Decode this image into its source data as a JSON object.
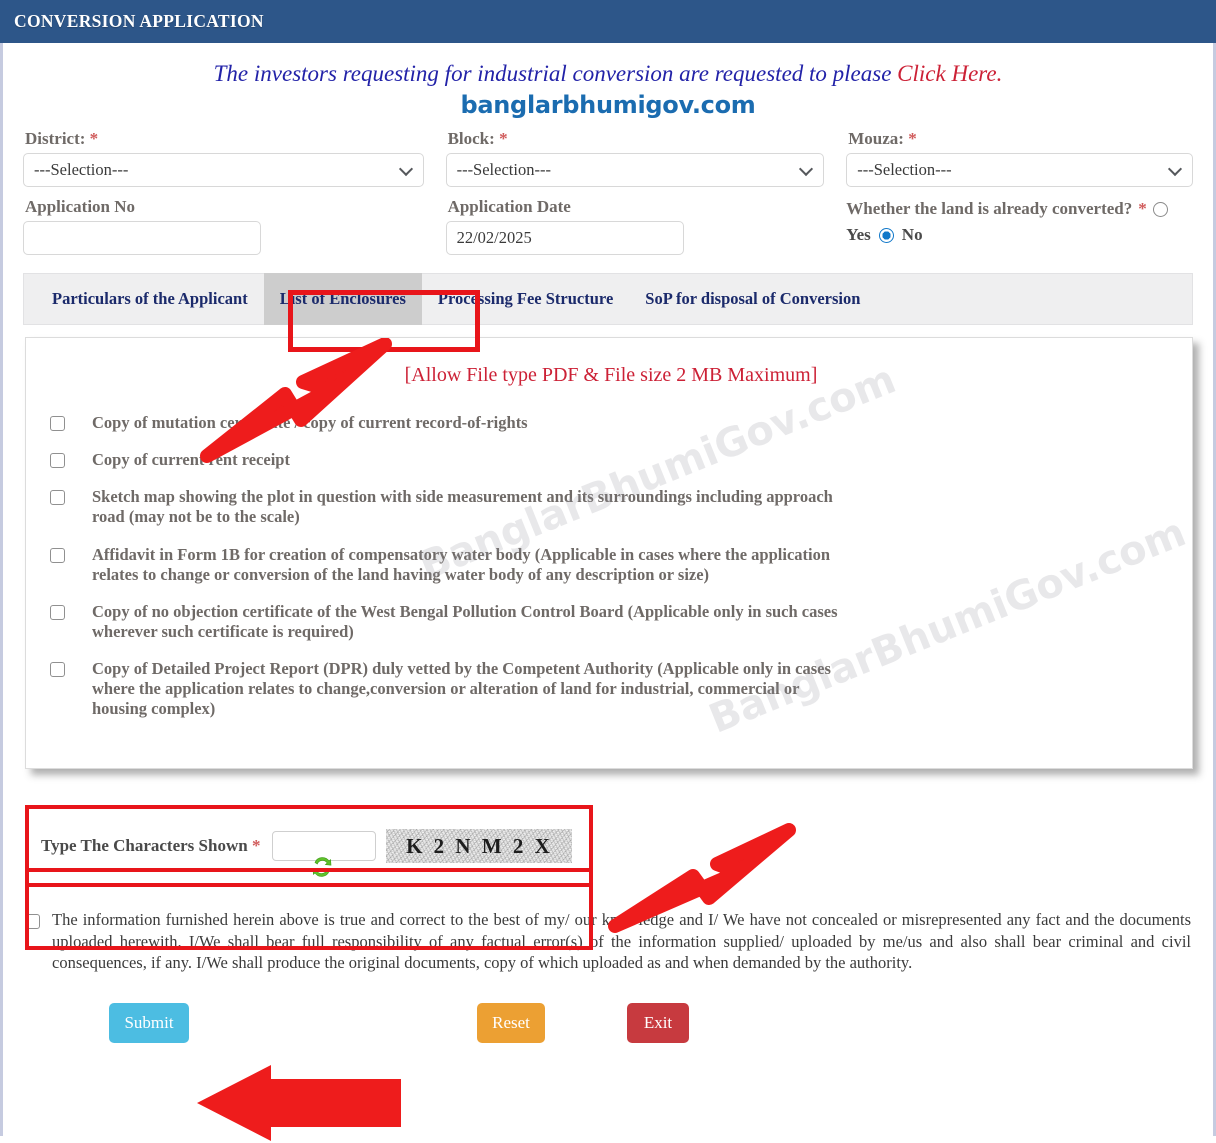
{
  "header": {
    "title": "CONVERSION APPLICATION"
  },
  "banner": {
    "text": "The investors requesting for industrial conversion are requested to please ",
    "link": "Click Here.",
    "site": "banglarbhumigov.com"
  },
  "watermark": {
    "text": "BanglarBhumiGov.com"
  },
  "form": {
    "district": {
      "label": "District:",
      "required": "*",
      "value": "---Selection---"
    },
    "block": {
      "label": "Block:",
      "required": "*",
      "value": "---Selection---"
    },
    "mouza": {
      "label": "Mouza:",
      "required": "*",
      "value": "---Selection---"
    },
    "application_no": {
      "label": "Application No",
      "value": ""
    },
    "application_date": {
      "label": "Application Date",
      "value": "22/02/2025"
    },
    "converted": {
      "question": "Whether the land is already converted?",
      "required": "*",
      "yes_label": "Yes",
      "no_label": "No",
      "selected": "No"
    }
  },
  "tabs": [
    {
      "label": "Particulars of the Applicant",
      "active": false
    },
    {
      "label": "List of Enclosures",
      "active": true
    },
    {
      "label": "Processing Fee Structure",
      "active": false
    },
    {
      "label": "SoP for disposal of Conversion",
      "active": false
    }
  ],
  "enclosures": {
    "note": "[Allow File type PDF & File size 2 MB Maximum]",
    "items": [
      {
        "label": "Copy of mutation certificate / copy of current record-of-rights",
        "checked": false
      },
      {
        "label": "Copy of current rent receipt",
        "checked": false
      },
      {
        "label": "Sketch map showing the plot in question with side measurement and its surroundings including approach road (may not be to the scale)",
        "checked": false
      },
      {
        "label": "Affidavit in Form 1B for creation of compensatory water body (Applicable in cases where the application relates to change or conversion of the land having water body of any description or size)",
        "checked": false
      },
      {
        "label": "Copy of no objection certificate of the West Bengal Pollution Control Board (Applicable only in such cases wherever such certificate is required)",
        "checked": false
      },
      {
        "label": "Copy of Detailed Project Report (DPR) duly vetted by the Competent Authority (Applicable only in cases where the application relates to change,conversion or alteration of land for industrial, commercial or housing complex)",
        "checked": false
      }
    ]
  },
  "captcha": {
    "label": "Type The Characters Shown",
    "required": "*",
    "input_value": "",
    "code": "K 2 N M 2 X",
    "refresh_icon": "refresh-icon"
  },
  "declaration": {
    "checked": false,
    "text": "The information furnished herein above is true and correct to the best of my/ our knowledge and I/ We have not concealed or misrepresented any fact and the documents uploaded herewith. I/We shall bear full responsibility of any factual error(s) of the information supplied/ uploaded by me/us and also shall bear criminal and civil consequences, if any. I/We shall produce the original documents, copy of which uploaded as and when demanded by the authority."
  },
  "buttons": {
    "submit": "Submit",
    "reset": "Reset",
    "exit": "Exit"
  },
  "colors": {
    "header_blue": "#2d5689",
    "banner_blue": "#2222a8",
    "link_red": "#cc2136",
    "annotation_red": "#e8151a",
    "submit": "#4cbde2",
    "reset": "#eca033",
    "exit": "#c73a3f",
    "tab_navy": "#1b2a6b"
  }
}
